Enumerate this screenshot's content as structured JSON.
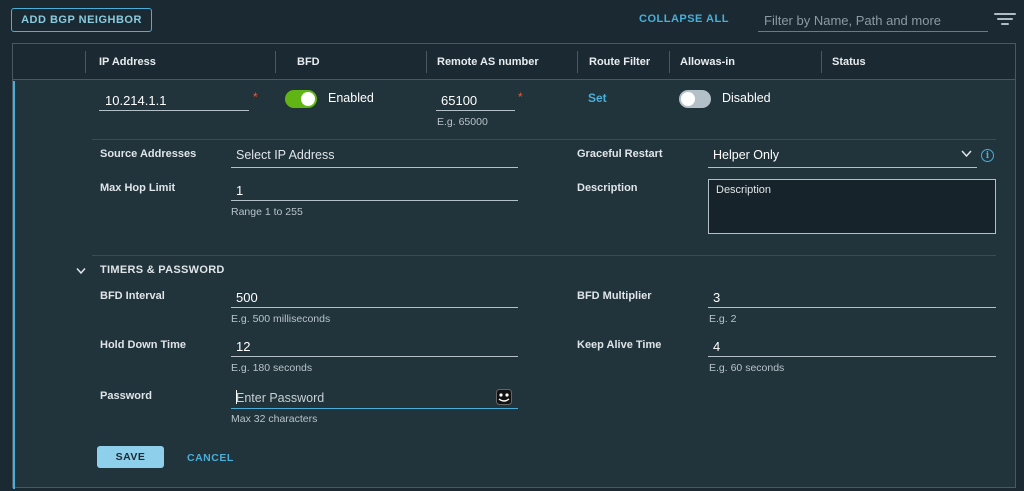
{
  "toolbar": {
    "add_button": "ADD BGP NEIGHBOR",
    "collapse_all": "COLLAPSE ALL",
    "filter_placeholder": "Filter by Name, Path and more",
    "filter_icon": "filter-lines-icon"
  },
  "grid": {
    "columns": [
      "IP Address",
      "BFD",
      "Remote AS number",
      "Route Filter",
      "Allowas-in",
      "Status"
    ]
  },
  "row": {
    "ip_address": "10.214.1.1",
    "required_mark": "*",
    "bfd_label": "Enabled",
    "bfd_enabled": true,
    "remote_as": "65100",
    "remote_as_help": "E.g. 65000",
    "route_filter_link": "Set",
    "allowas_label": "Disabled",
    "allowas_enabled": false
  },
  "form": {
    "source_addresses_label": "Source Addresses",
    "source_addresses_placeholder": "Select IP Address",
    "graceful_restart_label": "Graceful Restart",
    "graceful_restart_value": "Helper Only",
    "max_hop_label": "Max Hop Limit",
    "max_hop_value": "1",
    "max_hop_help": "Range 1 to 255",
    "description_label": "Description",
    "description_placeholder": "Description"
  },
  "timers": {
    "section_title": "TIMERS & PASSWORD",
    "bfd_interval_label": "BFD Interval",
    "bfd_interval_value": "500",
    "bfd_interval_help": "E.g. 500 milliseconds",
    "bfd_multiplier_label": "BFD Multiplier",
    "bfd_multiplier_value": "3",
    "bfd_multiplier_help": "E.g. 2",
    "hold_down_label": "Hold Down Time",
    "hold_down_value": "12",
    "hold_down_help": "E.g. 180 seconds",
    "keep_alive_label": "Keep Alive Time",
    "keep_alive_value": "4",
    "keep_alive_help": "E.g. 60 seconds",
    "password_label": "Password",
    "password_placeholder": "Enter Password",
    "password_help": "Max 32 characters"
  },
  "actions": {
    "save": "SAVE",
    "cancel": "CANCEL"
  },
  "colors": {
    "accent": "#49afd9",
    "toggle_on": "#60b515",
    "toggle_off": "#b4c0c7",
    "required": "#e85d40"
  }
}
